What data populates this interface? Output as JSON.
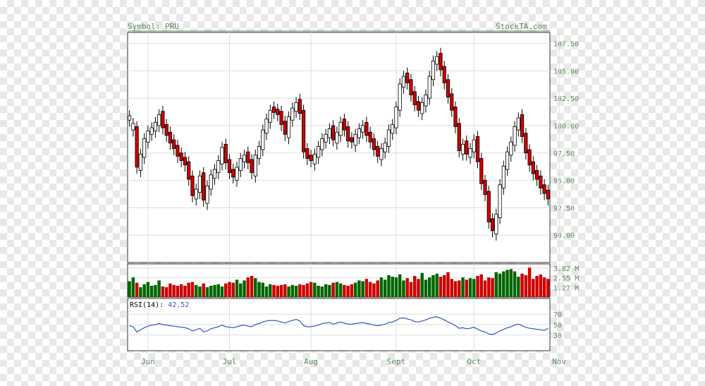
{
  "header": {
    "symbol_label": "Symbol: PRU",
    "site": "StockTA.com"
  },
  "colors": {
    "up": "#006600",
    "down": "#cc0000",
    "rsi_line": "#3355bb",
    "axis_text": "#5a8a5a",
    "grid": "#dddddd",
    "frame": "#333333"
  },
  "chart_data": [
    {
      "type": "candlestick",
      "title": "",
      "ylim": [
        87.5,
        108.5
      ],
      "y_ticks": [
        "107.50",
        "105.00",
        "102.50",
        "100.00",
        "97.50",
        "95.00",
        "92.50",
        "90.00"
      ],
      "y_tick_values": [
        107.5,
        105,
        102.5,
        100,
        97.5,
        95,
        92.5,
        90
      ],
      "x_labels": [
        "Jun",
        "Jul",
        "Aug",
        "Sept",
        "Oct",
        "Nov"
      ],
      "x_label_index": [
        5,
        27,
        49,
        72,
        93,
        116
      ],
      "closes": [
        100.5,
        99.6,
        96.2,
        97.4,
        98.8,
        99.5,
        99.8,
        100.3,
        101.0,
        99.8,
        99.1,
        98.4,
        97.9,
        97.2,
        96.8,
        96.4,
        95.1,
        93.6,
        94.2,
        95.4,
        93.2,
        94.5,
        95.5,
        96.0,
        96.8,
        98.0,
        96.6,
        95.7,
        95.3,
        96.2,
        97.0,
        97.3,
        96.6,
        95.7,
        97.3,
        98.1,
        99.6,
        100.6,
        101.4,
        101.2,
        101.0,
        100.1,
        99.2,
        100.8,
        101.6,
        102.1,
        101.1,
        97.6,
        97.0,
        96.8,
        97.4,
        98.1,
        98.8,
        99.2,
        99.7,
        98.7,
        99.4,
        100.3,
        99.6,
        98.6,
        98.5,
        99.2,
        99.7,
        100.0,
        99.1,
        98.5,
        97.8,
        97.2,
        97.9,
        98.4,
        99.6,
        100.1,
        101.7,
        103.8,
        104.5,
        103.9,
        102.8,
        101.9,
        101.4,
        102.1,
        102.8,
        104.5,
        105.9,
        106.3,
        105.1,
        103.9,
        102.6,
        101.4,
        99.9,
        97.7,
        98.3,
        97.4,
        97.9,
        98.7,
        96.7,
        94.7,
        93.7,
        91.2,
        90.4,
        91.9,
        94.6,
        96.3,
        97.6,
        98.5,
        99.9,
        100.7,
        99.0,
        97.5,
        96.4,
        95.6,
        95.1,
        94.3,
        93.8,
        93.3
      ],
      "volumes": [
        2.1,
        2.6,
        1.9,
        1.3,
        1.7,
        2.0,
        1.5,
        1.6,
        2.2,
        1.4,
        1.3,
        1.8,
        1.6,
        1.5,
        1.7,
        1.5,
        1.9,
        2.0,
        1.6,
        1.4,
        1.8,
        1.3,
        1.5,
        1.6,
        1.7,
        1.4,
        1.8,
        2.0,
        1.9,
        2.3,
        1.8,
        2.2,
        2.6,
        2.8,
        2.5,
        2.0,
        1.9,
        1.4,
        1.7,
        1.6,
        1.5,
        1.6,
        1.7,
        1.4,
        1.6,
        1.5,
        1.7,
        1.6,
        1.8,
        2.0,
        1.9,
        1.5,
        1.4,
        1.7,
        1.6,
        1.9,
        2.0,
        1.8,
        1.6,
        1.5,
        1.7,
        1.9,
        2.2,
        2.1,
        2.4,
        2.0,
        1.8,
        2.2,
        2.6,
        2.3,
        2.9,
        2.7,
        2.6,
        3.0,
        2.2,
        2.5,
        2.0,
        2.8,
        2.4,
        3.2,
        2.3,
        2.6,
        2.9,
        3.1,
        2.7,
        2.9,
        3.3,
        2.4,
        2.1,
        2.2,
        2.6,
        2.3,
        2.5,
        2.4,
        2.8,
        3.0,
        2.2,
        2.6,
        2.5,
        3.3,
        3.1,
        3.4,
        3.6,
        3.7,
        3.4,
        2.7,
        3.1,
        2.9,
        3.9,
        2.4,
        2.8,
        3.0,
        2.6,
        2.4
      ],
      "volume_ticks": [
        "3.82 M",
        "2.55 M",
        "1.27 M"
      ],
      "volume_tick_values": [
        3.82,
        2.55,
        1.27
      ],
      "rsi_label": "RSI(14): 42.52",
      "rsi_ticks": [
        "70",
        "50",
        "30"
      ],
      "rsi_tick_values": [
        70,
        50,
        30
      ],
      "rsi": [
        48,
        46,
        36,
        40,
        44,
        47,
        49,
        50,
        52,
        50,
        49,
        48,
        47,
        46,
        45,
        44,
        42,
        38,
        40,
        43,
        36,
        38,
        42,
        44,
        46,
        49,
        46,
        45,
        44,
        46,
        48,
        49,
        47,
        46,
        50,
        52,
        55,
        57,
        58,
        58,
        57,
        55,
        53,
        56,
        58,
        60,
        57,
        48,
        46,
        46,
        47,
        49,
        52,
        53,
        54,
        51,
        53,
        55,
        53,
        51,
        51,
        52,
        53,
        54,
        52,
        51,
        49,
        48,
        49,
        51,
        54,
        55,
        58,
        62,
        63,
        61,
        59,
        56,
        55,
        57,
        59,
        62,
        64,
        65,
        62,
        59,
        55,
        52,
        48,
        43,
        44,
        42,
        43,
        45,
        41,
        38,
        36,
        32,
        31,
        34,
        38,
        41,
        44,
        46,
        49,
        51,
        48,
        45,
        43,
        42,
        41,
        40,
        39,
        43
      ],
      "bar_colors": [
        0,
        0,
        1,
        0,
        0,
        0,
        0,
        0,
        0,
        1,
        1,
        1,
        1,
        1,
        1,
        1,
        1,
        1,
        0,
        0,
        1,
        0,
        0,
        0,
        0,
        0,
        1,
        1,
        1,
        0,
        0,
        0,
        1,
        1,
        0,
        0,
        0,
        0,
        0,
        1,
        1,
        1,
        1,
        0,
        0,
        0,
        1,
        1,
        1,
        1,
        0,
        0,
        0,
        0,
        0,
        1,
        0,
        0,
        1,
        1,
        1,
        0,
        0,
        0,
        1,
        1,
        1,
        1,
        0,
        0,
        0,
        0,
        0,
        0,
        0,
        1,
        1,
        1,
        1,
        0,
        0,
        0,
        0,
        0,
        1,
        1,
        1,
        1,
        1,
        1,
        0,
        1,
        0,
        0,
        1,
        1,
        1,
        1,
        1,
        0,
        0,
        0,
        0,
        0,
        0,
        0,
        1,
        1,
        1,
        1,
        1,
        1,
        1,
        1
      ]
    }
  ]
}
